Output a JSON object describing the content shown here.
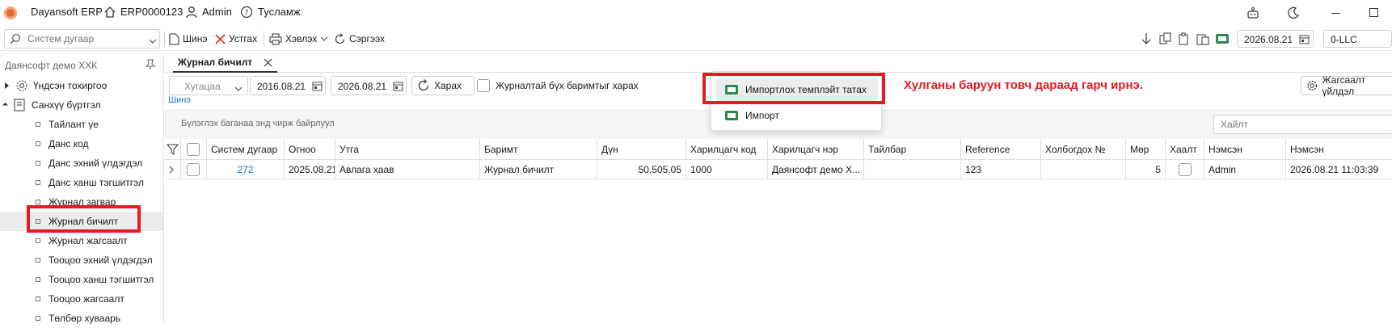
{
  "titlebar": {
    "app_name": "Dayansoft ERP",
    "doc_code": "ERP0000123",
    "user": "Admin",
    "help": "Тусламж"
  },
  "toolbar": {
    "search_placeholder": "Систем дугаар",
    "new_label": "Шинэ",
    "delete_label": "Устгах",
    "print_label": "Хэвлэх",
    "refresh_label": "Сэргээх",
    "date": "2026.08.21",
    "company_code": "0-LLC"
  },
  "sidebar": {
    "company": "Даянсофт демо ХХК",
    "top_items": [
      {
        "label": "Үндсэн тохиргоо"
      },
      {
        "label": "Санхүү бүртгэл"
      }
    ],
    "items": [
      {
        "label": "Тайлант үе"
      },
      {
        "label": "Данс код"
      },
      {
        "label": "Данс эхний үлдэгдэл"
      },
      {
        "label": "Данс ханш тэгшитгэл"
      },
      {
        "label": "Журнал загвар"
      },
      {
        "label": "Журнал бичилт"
      },
      {
        "label": "Журнал жагсаалт"
      },
      {
        "label": "Тооцоо эхний үлдэгдэл"
      },
      {
        "label": "Тооцоо ханш тэгшитгэл"
      },
      {
        "label": "Тооцоо жагсаалт"
      },
      {
        "label": "Төлбөр хуваарь"
      }
    ]
  },
  "tabs": [
    {
      "label": "Журнал бичилт"
    }
  ],
  "filter": {
    "period_placeholder": "Хугацаа",
    "date_from": "2016.08.21",
    "date_to": "2026.08.21",
    "view_label": "Харах",
    "all_docs_label": "Журналтай бүх баримтыг харах",
    "new_link": "Шинэ",
    "settings_label": "Жагсаалт үйлдэл"
  },
  "group_panel": {
    "hint": "Бүлэглэх баганаа энд чирж байрлуул",
    "search_placeholder": "Хайлт"
  },
  "context_menu": {
    "items": [
      {
        "label": "Импортлох темплэйт татах"
      },
      {
        "label": "Импорт"
      }
    ]
  },
  "annotation": "Хулганы баруун товч дараад гарч ирнэ.",
  "grid": {
    "columns": [
      "Систем дугаар",
      "Огноо",
      "Утга",
      "Баримт",
      "Дүн",
      "Харилцагч код",
      "Харилцагч нэр",
      "Тайлбар",
      "Reference",
      "Холбогдох №",
      "Мөр",
      "Хаалт",
      "Нэмсэн",
      "Нэмсэн"
    ],
    "rows": [
      [
        "272",
        "2025.08.21",
        "Авлага хаав",
        "Журнал бичилт",
        "50,505.05",
        "1000",
        "Даянсофт демо Х...",
        "",
        "123",
        "",
        "5",
        "",
        "Admin",
        "2026.08.21 11:03:39"
      ]
    ]
  },
  "colors": {
    "accent_red": "#e31b23",
    "link_blue": "#1a73c7",
    "logo_orange": "#e8692c"
  }
}
